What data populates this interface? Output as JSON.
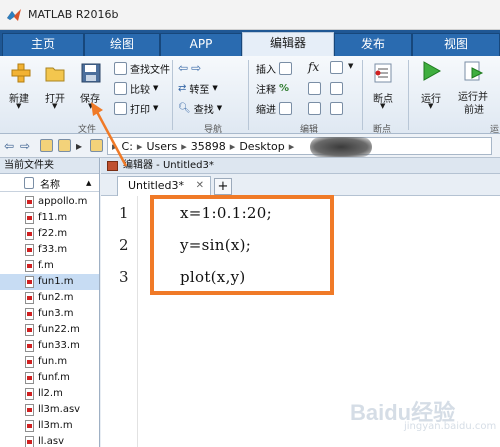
{
  "window": {
    "title": "MATLAB R2016b"
  },
  "ribbon_tabs": [
    {
      "label": "主页",
      "active": false
    },
    {
      "label": "绘图",
      "active": false
    },
    {
      "label": "APP",
      "active": false
    },
    {
      "label": "编辑器",
      "active": true
    },
    {
      "label": "发布",
      "active": false
    },
    {
      "label": "视图",
      "active": false
    }
  ],
  "ribbon": {
    "new_label": "新建",
    "open_label": "打开",
    "save_label": "保存",
    "find_files_label": "查找文件",
    "compare_label": "比较",
    "print_label": "打印",
    "file_group": "文件",
    "goto_label": "转至",
    "find_label": "查找",
    "nav_group": "导航",
    "insert_label": "插入",
    "fx_label": "fx",
    "comment_label": "注释",
    "indent_label": "缩进",
    "edit_group": "编辑",
    "breakpoints_label": "断点",
    "breakpoints_group": "断点",
    "run_label": "运行",
    "run_advance_label_1": "运行并",
    "run_advance_label_2": "前进",
    "run_group": "运"
  },
  "path": {
    "segments": [
      "C:",
      "Users",
      "35898",
      "Desktop"
    ]
  },
  "current_folder": {
    "panel_title": "当前文件夹",
    "column_name": "名称",
    "files": [
      {
        "name": "appollo.m",
        "selected": false
      },
      {
        "name": "f11.m",
        "selected": false
      },
      {
        "name": "f22.m",
        "selected": false
      },
      {
        "name": "f33.m",
        "selected": false
      },
      {
        "name": "f.m",
        "selected": false
      },
      {
        "name": "fun1.m",
        "selected": true
      },
      {
        "name": "fun2.m",
        "selected": false
      },
      {
        "name": "fun3.m",
        "selected": false
      },
      {
        "name": "fun22.m",
        "selected": false
      },
      {
        "name": "fun33.m",
        "selected": false
      },
      {
        "name": "fun.m",
        "selected": false
      },
      {
        "name": "funf.m",
        "selected": false
      },
      {
        "name": "ll2.m",
        "selected": false
      },
      {
        "name": "ll3m.asv",
        "selected": false
      },
      {
        "name": "ll3m.m",
        "selected": false
      },
      {
        "name": "ll.asv",
        "selected": false
      }
    ]
  },
  "editor": {
    "header": "编辑器 - Untitled3*",
    "tab_label": "Untitled3*",
    "close_glyph": "✕",
    "add_glyph": "+",
    "lines": [
      {
        "number": "1",
        "code": "x=1:0.1:20;"
      },
      {
        "number": "2",
        "code": "y=sin(x);"
      },
      {
        "number": "3",
        "code": "plot(x,y)"
      }
    ]
  },
  "watermark": {
    "brand": "Baidu经验",
    "sub": "jingyan.baidu.com"
  },
  "colors": {
    "ribbon_bar": "#1f5794",
    "highlight": "#f07a27",
    "selection": "#c7dcf3"
  }
}
